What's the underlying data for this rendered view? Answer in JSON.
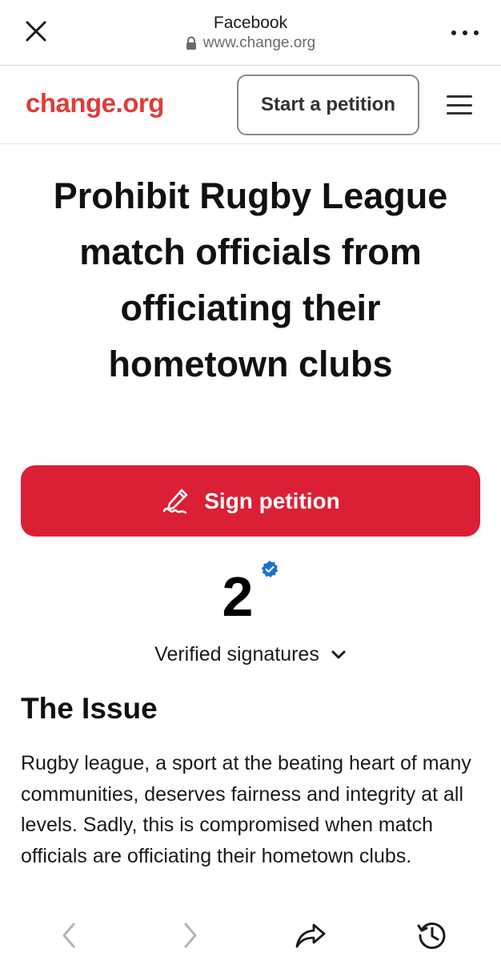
{
  "browser": {
    "title": "Facebook",
    "url": "www.change.org"
  },
  "header": {
    "logo_text": "change.org",
    "start_petition_label": "Start a petition"
  },
  "petition": {
    "title": "Prohibit Rugby League match officials from officiating their hometown clubs",
    "sign_label": "Sign petition",
    "signature_count": "2",
    "signatures_label": "Verified signatures"
  },
  "issue": {
    "heading": "The Issue",
    "body": "Rugby league, a sport at the beating heart of many communities, deserves fairness and integrity at all levels. Sadly, this is compromised when match officials are officiating their hometown clubs."
  },
  "icons": {
    "close": "close-icon",
    "lock": "lock-icon",
    "more": "more-icon",
    "menu": "hamburger-menu-icon",
    "sign": "pen-signature-icon",
    "verified": "verified-badge-icon",
    "chevron": "chevron-down-icon",
    "back": "back-arrow-icon",
    "forward": "forward-arrow-icon",
    "share": "share-icon",
    "history": "history-icon"
  },
  "colors": {
    "brand": "#e03b3b",
    "sign_button": "#db1f35",
    "verified": "#1a73c7"
  }
}
